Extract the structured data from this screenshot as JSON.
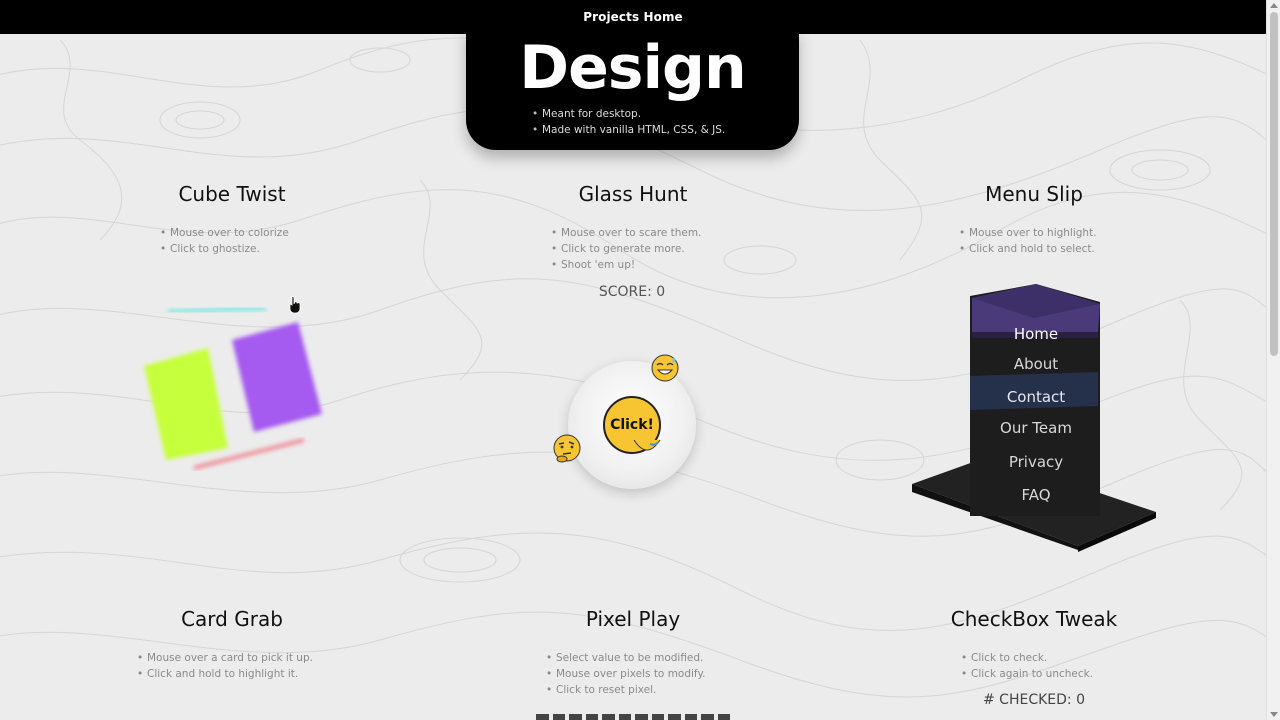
{
  "nav": {
    "home_link": "Projects Home"
  },
  "hero": {
    "title": "Design",
    "bullets": [
      "Meant for desktop.",
      "Made with vanilla HTML, CSS, & JS."
    ]
  },
  "projects": {
    "cube_twist": {
      "title": "Cube Twist",
      "bullets": [
        "Mouse over to colorize",
        "Click to ghostize."
      ]
    },
    "glass_hunt": {
      "title": "Glass Hunt",
      "bullets": [
        "Mouse over to scare them.",
        "Click to generate more.",
        "Shoot 'em up!"
      ],
      "score_label": "SCORE: 0",
      "button_label": "Click!"
    },
    "menu_slip": {
      "title": "Menu Slip",
      "bullets": [
        "Mouse over to highlight.",
        "Click and hold to select."
      ],
      "menu_items": [
        "Home",
        "About",
        "Contact",
        "Our Team",
        "Privacy",
        "FAQ"
      ]
    },
    "card_grab": {
      "title": "Card Grab",
      "bullets": [
        "Mouse over a card to pick it up.",
        "Click and hold to highlight it."
      ]
    },
    "pixel_play": {
      "title": "Pixel Play",
      "bullets": [
        "Select value to be modified.",
        "Mouse over pixels to modify.",
        "Click to reset pixel."
      ]
    },
    "checkbox_tweak": {
      "title": "CheckBox Tweak",
      "bullets": [
        "Click to check.",
        "Click again to uncheck."
      ],
      "checked_label": "# CHECKED: 0"
    }
  },
  "colors": {
    "accent_yellow": "#f7c531",
    "menu_purple": "#4a3a7a",
    "cube_lime": "#c6ff3a",
    "cube_violet": "#a55af0"
  },
  "icons": [
    "cursor-hand-icon",
    "grin-sweat-emoji-icon",
    "thinking-emoji-icon"
  ]
}
